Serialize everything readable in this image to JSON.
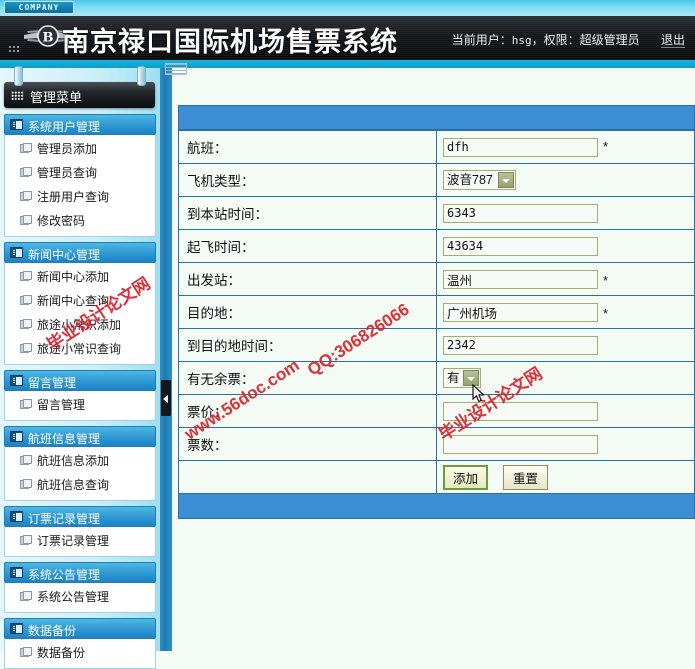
{
  "topbar": {
    "company_tab": "COMPANY"
  },
  "header": {
    "title": "南京禄口国际机场售票系统",
    "logo_icon": "winged-b-emblem",
    "user_info": "当前用户：hsg，权限：超级管理员",
    "user_label": "当前用户：",
    "user_name": "hsg",
    "role_label": "，权限：超级管理员",
    "logout_label": "退出"
  },
  "sidebar": {
    "menu_title": "管理菜单",
    "groups": [
      {
        "title": "系统用户管理",
        "items": [
          "管理员添加",
          "管理员查询",
          "注册用户查询",
          "修改密码"
        ]
      },
      {
        "title": "新闻中心管理",
        "items": [
          "新闻中心添加",
          "新闻中心查询",
          "旅途小常识添加",
          "旅途小常识查询"
        ]
      },
      {
        "title": "留言管理",
        "items": [
          "留言管理"
        ]
      },
      {
        "title": "航班信息管理",
        "items": [
          "航班信息添加",
          "航班信息查询"
        ]
      },
      {
        "title": "订票记录管理",
        "items": [
          "订票记录管理"
        ]
      },
      {
        "title": "系统公告管理",
        "items": [
          "系统公告管理"
        ]
      },
      {
        "title": "数据备份",
        "items": [
          "数据备份"
        ]
      }
    ]
  },
  "form": {
    "rows": [
      {
        "label": "航班：",
        "type": "text",
        "value": "dfh",
        "required": "*"
      },
      {
        "label": "飞机类型：",
        "type": "select",
        "value": "波音787",
        "required": ""
      },
      {
        "label": "到本站时间：",
        "type": "text",
        "value": "6343",
        "required": ""
      },
      {
        "label": "起飞时间：",
        "type": "text",
        "value": "43634",
        "required": ""
      },
      {
        "label": "出发站：",
        "type": "text",
        "value": "温州",
        "required": "*"
      },
      {
        "label": "目的地：",
        "type": "text",
        "value": "广州机场",
        "required": "*"
      },
      {
        "label": "到目的地时间：",
        "type": "text",
        "value": "2342",
        "required": ""
      },
      {
        "label": "有无余票：",
        "type": "select-small",
        "value": "有",
        "required": ""
      },
      {
        "label": "票价：",
        "type": "text",
        "value": "",
        "required": ""
      },
      {
        "label": "票数：",
        "type": "text",
        "value": "",
        "required": ""
      }
    ],
    "submit_label": "添加",
    "reset_label": "重置"
  },
  "watermarks": {
    "a": "毕业设计论文网",
    "b": "www.56doc.com",
    "c": "QQ:306826066",
    "d": "毕业设计论文网"
  },
  "colors": {
    "accent_blue": "#3d8ed5",
    "banner_dark": "#14171a",
    "cyan": "#19b4dc",
    "input_border": "#a6ac72",
    "watermark_red": "#d9202a"
  }
}
